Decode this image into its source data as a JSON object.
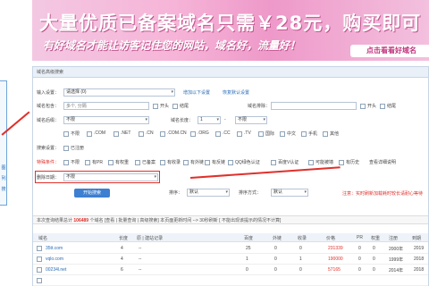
{
  "banner": {
    "title": "大量优质已备案域名只需￥28元，购买即可",
    "subtitle": "有好域名才能让访客记住您的网站，域名好，流量好！",
    "cta": "点击看看好域名"
  },
  "left_panel": {
    "links": [
      "图",
      "列",
      "搜"
    ]
  },
  "panel": {
    "header": "域名高级搜索",
    "rows": {
      "r1": {
        "label": "输入设置：",
        "select": "请选择 (0)",
        "link1": "增加以下设置",
        "link2": "恢复默认设置"
      },
      "r2": {
        "label": "域名包含：",
        "placeholder": "多个, 分隔",
        "chk1": "开头",
        "chk2": "结尾",
        "label2": "域名排除：",
        "chk3": "开头",
        "chk4": "结尾"
      },
      "r3": {
        "label": "域名后缀：",
        "select": "不限",
        "label2": "域名长度：",
        "from": "1",
        "to": "不限"
      },
      "r4": {
        "label": "",
        "options": [
          "不限",
          ".COM",
          ".NET",
          ".CN",
          ".COM.CN",
          ".ORG",
          ".CC",
          ".TV",
          "国际",
          "中文",
          "手机",
          "其他"
        ]
      },
      "r5": {
        "label": "搜索设置：",
        "chk": "已注册"
      },
      "r6": {
        "label": "特殊条件：",
        "options": [
          "不限",
          "有PR",
          "有权重",
          "已备案",
          "有收录",
          "有外链",
          "有反链",
          "QQ绿色认证",
          "百度V认证",
          "可能被墙",
          "有历史"
        ],
        "link": "查看详细说明"
      },
      "r7": {
        "label": "删除日期：",
        "select": "不限"
      },
      "r8": {
        "label": "",
        "btn_label": "开始搜索",
        "label_order": "排序：",
        "order_select": "默认",
        "label_sort": "排序方式：",
        "sort_select": "默认"
      }
    },
    "note": "注意：实时刷新加载耗时较长请耐心等待",
    "result": {
      "prefix": "本次查询结果总计",
      "count": "106489",
      "suffix": "个域名 [查看 | 批量查询 | 高级搜索] 本页面更新时间 --> 30秒刷新 [ 不能出现该提示的情况不计算]"
    },
    "table": {
      "headers": [
        "域名",
        "长度",
        "原 | 建站记录",
        "百度",
        "外链",
        "收录",
        "价格",
        "PR",
        "权重",
        "注册",
        "到期"
      ],
      "rows": [
        {
          "domain": "35tt.com",
          "len": "4",
          "history": "--",
          "baidu": "25",
          "ext": "0",
          "idx": "0",
          "price": "231339",
          "pr": "0",
          "weight": "0",
          "reg": "2000年",
          "exp": "2019"
        },
        {
          "domain": "vqlo.com",
          "len": "4",
          "history": "--",
          "baidu": "1",
          "ext": "0",
          "idx": "1",
          "price": "190000",
          "pr": "0",
          "weight": "0",
          "reg": "1999年",
          "exp": "2018"
        },
        {
          "domain": "00234l.net",
          "len": "6",
          "history": "--",
          "baidu": "0",
          "ext": "0",
          "idx": "0",
          "price": "57165",
          "pr": "0",
          "weight": "0",
          "reg": "2014年",
          "exp": "2018"
        },
        {
          "domain": "",
          "len": "",
          "history": "",
          "baidu": "",
          "ext": "",
          "idx": "",
          "price": "",
          "pr": "",
          "weight": "",
          "reg": "",
          "exp": ""
        }
      ]
    }
  },
  "colors": {
    "accent": "#3d7fd0",
    "highlight": "#e0302b",
    "banner": "#ee99c9"
  }
}
